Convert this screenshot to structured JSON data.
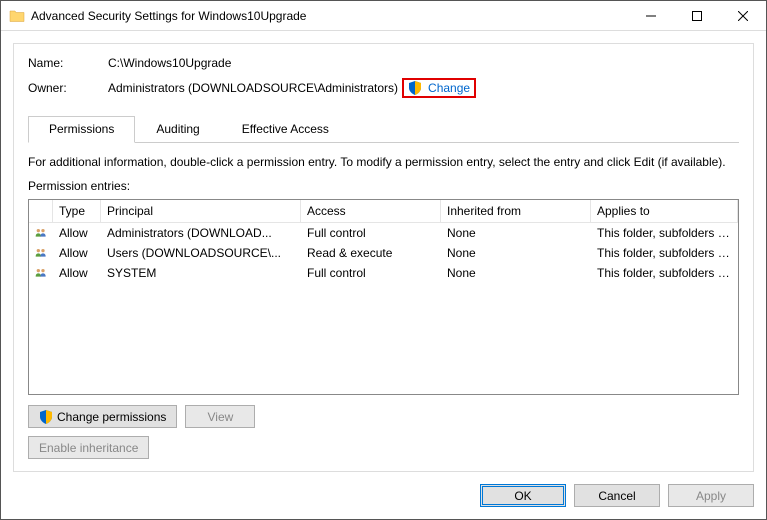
{
  "titlebar": {
    "title": "Advanced Security Settings for Windows10Upgrade"
  },
  "info": {
    "name_label": "Name:",
    "name_value": "C:\\Windows10Upgrade",
    "owner_label": "Owner:",
    "owner_value": "Administrators (DOWNLOADSOURCE\\Administrators)",
    "change_link": "Change"
  },
  "tabs": {
    "permissions": "Permissions",
    "auditing": "Auditing",
    "effective": "Effective Access"
  },
  "instruction": "For additional information, double-click a permission entry. To modify a permission entry, select the entry and click Edit (if available).",
  "entries_label": "Permission entries:",
  "columns": {
    "type": "Type",
    "principal": "Principal",
    "access": "Access",
    "inherited": "Inherited from",
    "applies": "Applies to"
  },
  "rows": [
    {
      "type": "Allow",
      "principal": "Administrators (DOWNLOAD...",
      "access": "Full control",
      "inherited": "None",
      "applies": "This folder, subfolders and files"
    },
    {
      "type": "Allow",
      "principal": "Users (DOWNLOADSOURCE\\...",
      "access": "Read & execute",
      "inherited": "None",
      "applies": "This folder, subfolders and files"
    },
    {
      "type": "Allow",
      "principal": "SYSTEM",
      "access": "Full control",
      "inherited": "None",
      "applies": "This folder, subfolders and files"
    }
  ],
  "buttons": {
    "change_permissions": "Change permissions",
    "view": "View",
    "enable_inheritance": "Enable inheritance",
    "ok": "OK",
    "cancel": "Cancel",
    "apply": "Apply"
  }
}
